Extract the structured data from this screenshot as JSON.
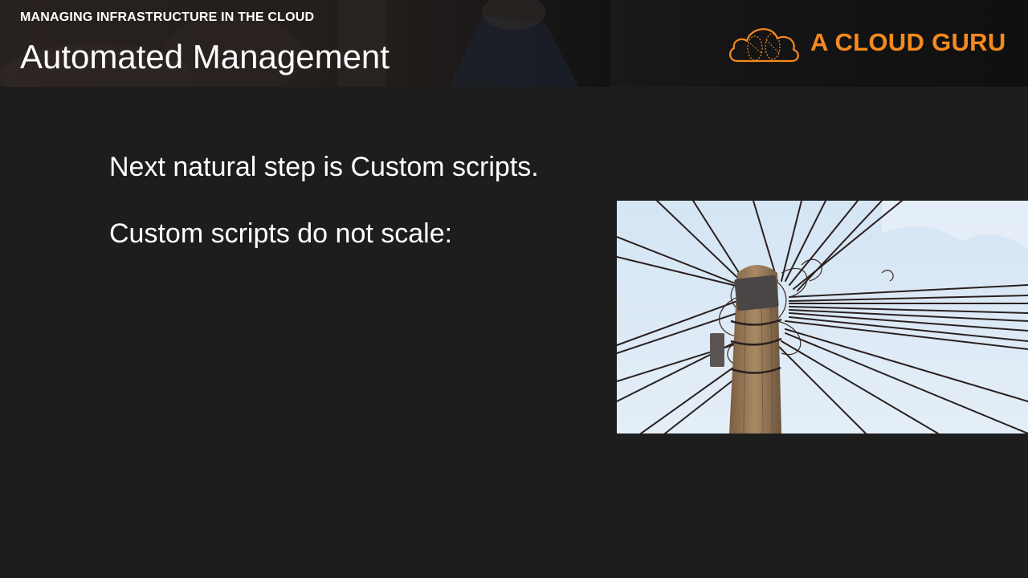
{
  "header": {
    "course_label": "MANAGING INFRASTRUCTURE IN THE CLOUD",
    "slide_title": "Automated Management"
  },
  "logo": {
    "brand_text": "A CLOUD GURU",
    "icon": "cloud-logo-icon"
  },
  "content": {
    "lines": [
      "Next natural step is Custom scripts.",
      "Custom scripts do not scale:"
    ]
  },
  "colors": {
    "background": "#1d1d1d",
    "text": "#ffffff",
    "brand_orange": "#f48a20",
    "sky": "#dbe9f5",
    "pole_wood": "#9a7b58"
  }
}
